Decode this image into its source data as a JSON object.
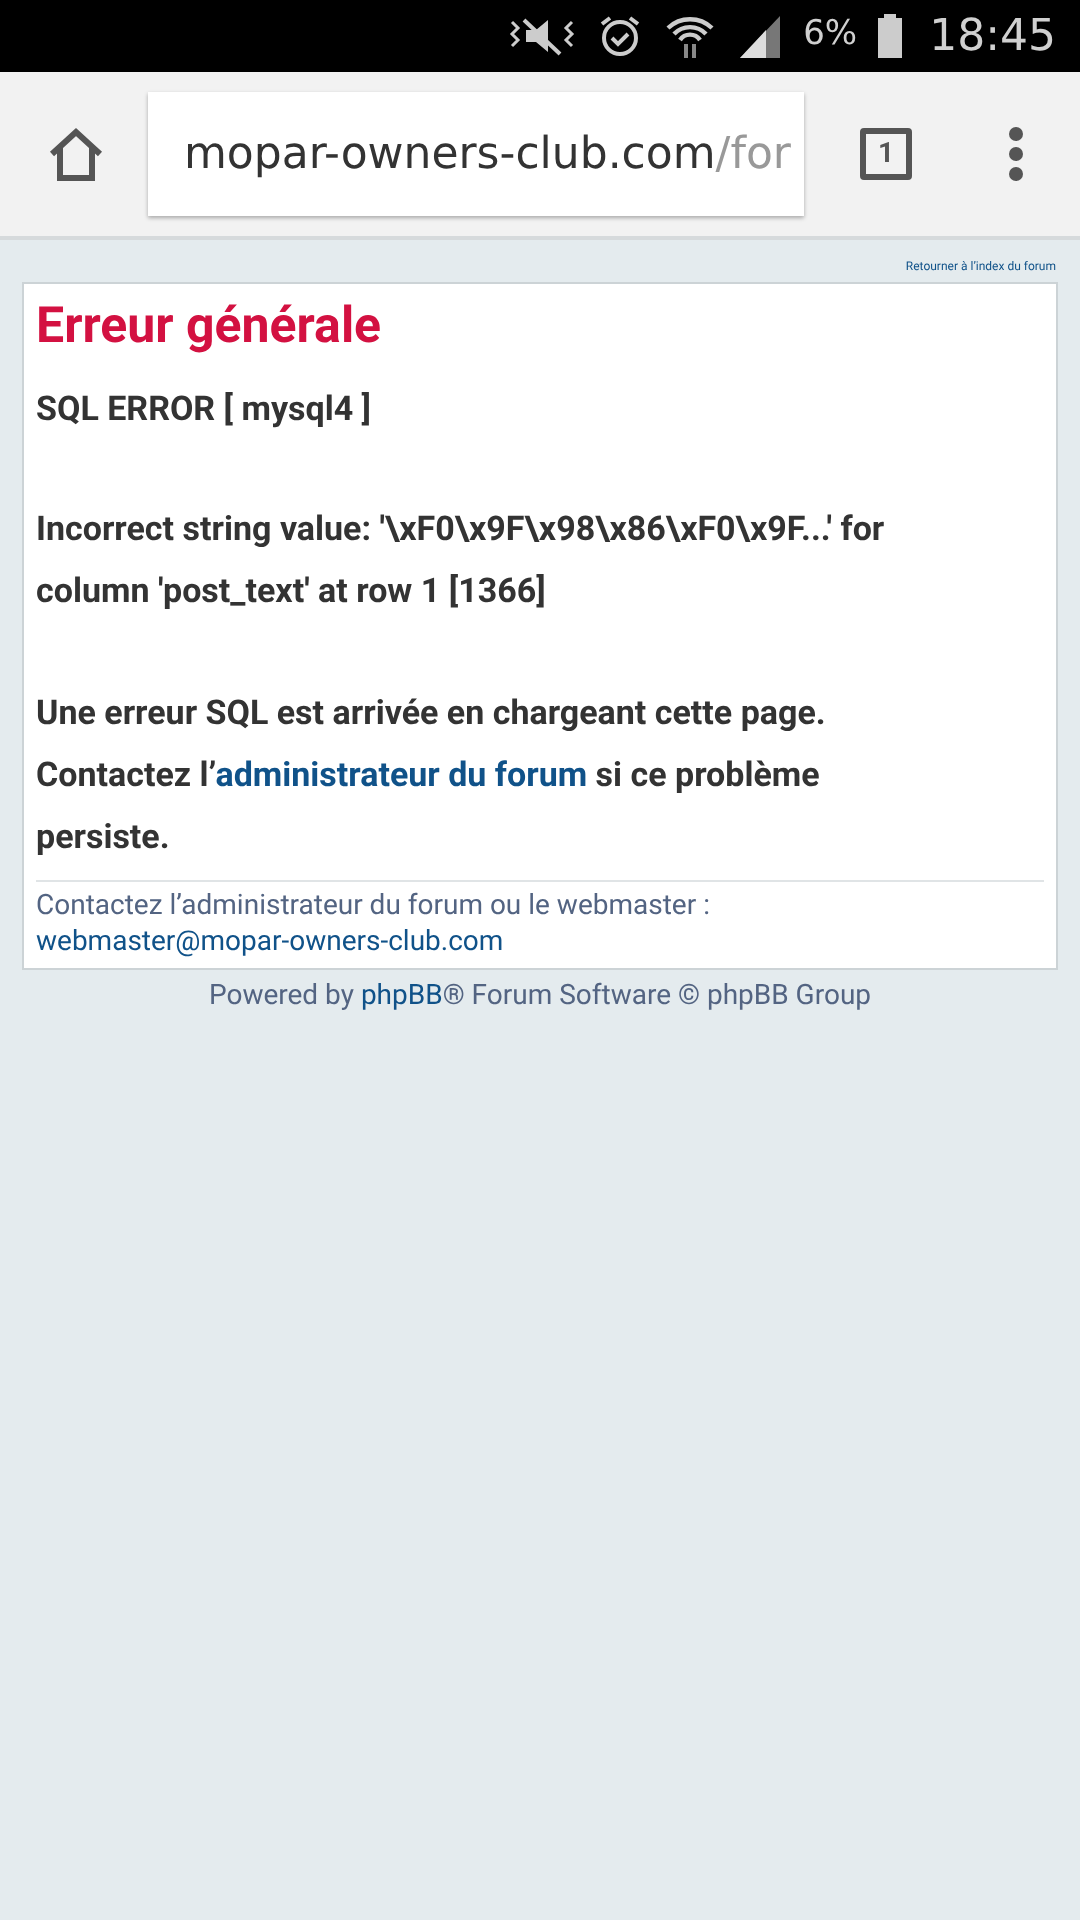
{
  "status_bar": {
    "battery": "6%",
    "time": "18:45"
  },
  "browser": {
    "url_host": "mopar-owners-club.com",
    "url_path": "/for",
    "tab_count": "1"
  },
  "page": {
    "back_link": "Retourner à l’index du forum",
    "title": "Erreur générale",
    "error_heading": "SQL ERROR [ mysql4 ]",
    "error_detail": "Incorrect string value: '\\xF0\\x9F\\x98\\x86\\xF0\\x9F...' for column 'post_text' at row 1 [1366]",
    "message": {
      "before": "Une erreur SQL est arrivée en chargeant cette page. Contactez l’",
      "link": "administrateur du forum",
      "after": " si ce problème persiste."
    },
    "contact": {
      "text": "Contactez l’administrateur du forum ou le webmaster :",
      "email": "webmaster@mopar-owners-club.com"
    },
    "footer": {
      "before": "Powered by ",
      "link": "phpBB",
      "after": "® Forum Software © phpBB Group"
    }
  }
}
